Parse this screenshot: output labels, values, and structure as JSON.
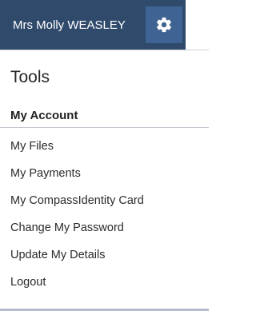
{
  "header": {
    "user_name": "Mrs Molly WEASLEY",
    "settings_icon": "gear-icon"
  },
  "menu": {
    "title": "Tools",
    "section_heading": "My Account",
    "items": [
      {
        "label": "My Files"
      },
      {
        "label": "My Payments"
      },
      {
        "label": "My CompassIdentity Card"
      },
      {
        "label": "Change My Password"
      },
      {
        "label": "Update My Details"
      },
      {
        "label": "Logout"
      }
    ]
  },
  "colors": {
    "header_background": "#2f4a6b",
    "gear_button_background": "#3f6494",
    "text": "#2b2b2b"
  }
}
